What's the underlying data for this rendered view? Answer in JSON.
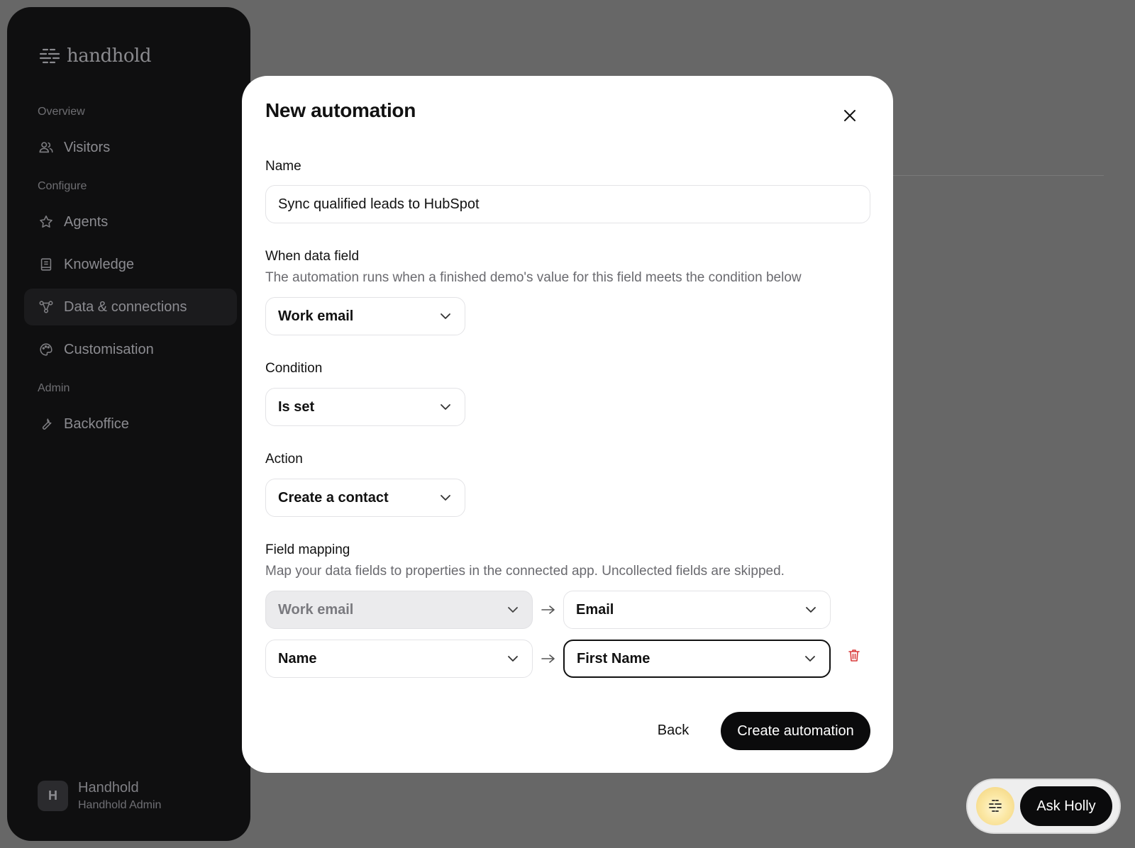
{
  "app": {
    "logo_text": "handhold"
  },
  "sidebar": {
    "sections": {
      "overview": "Overview",
      "configure": "Configure",
      "admin": "Admin"
    },
    "items": [
      {
        "label": "Visitors",
        "icon": "users-icon"
      },
      {
        "label": "Agents",
        "icon": "star-icon"
      },
      {
        "label": "Knowledge",
        "icon": "book-icon"
      },
      {
        "label": "Data & connections",
        "icon": "connections-icon",
        "active": true
      },
      {
        "label": "Customisation",
        "icon": "palette-icon"
      },
      {
        "label": "Backoffice",
        "icon": "wrench-icon"
      }
    ],
    "user": {
      "initial": "H",
      "name": "Handhold",
      "role": "Handhold Admin"
    }
  },
  "modal": {
    "title": "New automation",
    "name": {
      "label": "Name",
      "value": "Sync qualified leads to HubSpot"
    },
    "data_field": {
      "label": "When data field",
      "help": "The automation runs when a finished demo's value for this field meets the condition below",
      "value": "Work email"
    },
    "condition": {
      "label": "Condition",
      "value": "Is set"
    },
    "action": {
      "label": "Action",
      "value": "Create a contact"
    },
    "field_mapping": {
      "label": "Field mapping",
      "help": "Map your data fields to properties in the connected app. Uncollected fields are skipped.",
      "rows": [
        {
          "source": "Work email",
          "target": "Email"
        },
        {
          "source": "Name",
          "target": "First Name"
        }
      ]
    },
    "back_label": "Back",
    "submit_label": "Create automation"
  },
  "assistant": {
    "button_label": "Ask Holly"
  },
  "colors": {
    "delete": "#d93a3a",
    "primary": "#0b0b0c"
  }
}
